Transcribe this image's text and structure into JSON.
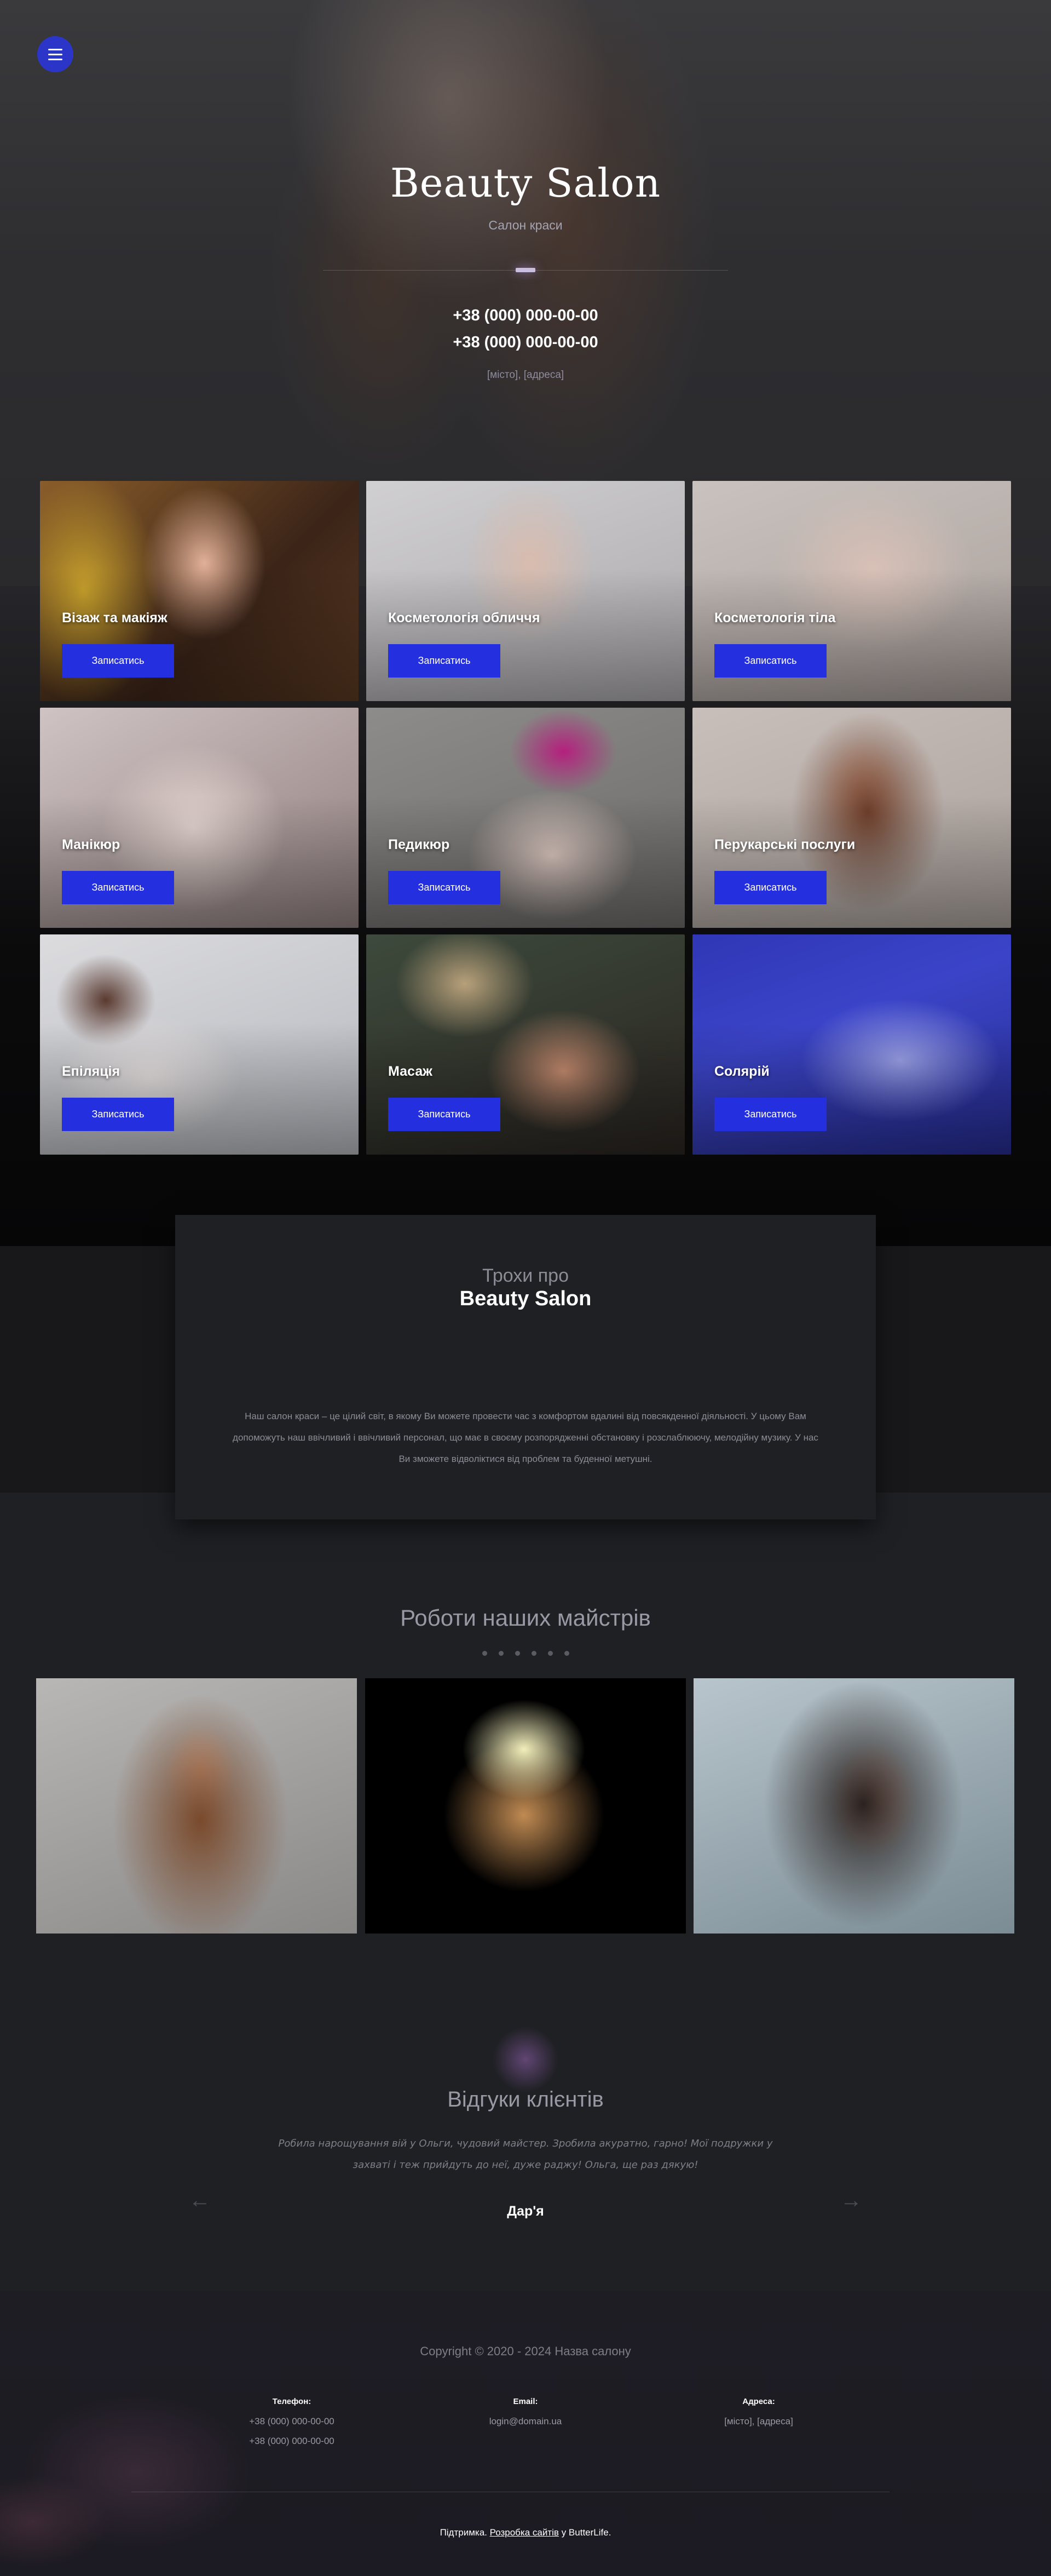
{
  "hero": {
    "title": "Beauty Salon",
    "subtitle": "Салон краси",
    "phone1": "+38 (000) 000-00-00",
    "phone2": "+38 (000) 000-00-00",
    "address": "[місто], [адреса]"
  },
  "menu": {
    "icon": "hamburger-menu-icon",
    "accent": "#2b35c8"
  },
  "services": {
    "button_color": "#2430e0",
    "items": [
      {
        "title": "Візаж та макіяж",
        "button": "Записатись"
      },
      {
        "title": "Косметологія обличчя",
        "button": "Записатись"
      },
      {
        "title": "Косметологія тіла",
        "button": "Записатись"
      },
      {
        "title": "Манікюр",
        "button": "Записатись"
      },
      {
        "title": "Педикюр",
        "button": "Записатись"
      },
      {
        "title": "Перукарські послуги",
        "button": "Записатись"
      },
      {
        "title": "Епіляція",
        "button": "Записатись"
      },
      {
        "title": "Масаж",
        "button": "Записатись"
      },
      {
        "title": "Солярій",
        "button": "Записатись"
      }
    ]
  },
  "about": {
    "pretitle": "Трохи про",
    "title": "Beauty Salon",
    "text": "Наш салон краси – це цілий світ, в якому Ви можете провести час з комфортом вдалині від повсякденної діяльності. У цьому Вам допоможуть наш ввічливий і ввічливий персонал, що має в своєму розпорядженні обстановку і розслаблюючу, мелодійну музику. У нас Ви зможете відволіктися від проблем та буденної метушні."
  },
  "works": {
    "title": "Роботи наших майстрів",
    "dot_count": 6
  },
  "reviews": {
    "title": "Відгуки клієнтів",
    "text": "Робила нарощування вій у Ольги, чудовий майстер. Зробила акуратно, гарно! Мої подружки у захваті і теж прийдуть до неї, дуже раджу! Ольга, ще раз дякую!",
    "author": "Дар'я",
    "prev_icon": "arrow-left-icon",
    "next_icon": "arrow-right-icon"
  },
  "footer": {
    "copyright": "Copyright © 2020 - 2024 Назва салону",
    "phone_label": "Телефон:",
    "phone1": "+38 (000) 000-00-00",
    "phone2": "+38 (000) 000-00-00",
    "email_label": "Email:",
    "email": "login@domain.ua",
    "address_label": "Адреса:",
    "address": "[місто], [адреса]",
    "credits_prefix": "Підтримка.",
    "credits_link": "Розробка сайтів",
    "credits_suffix": "у ButterLife."
  }
}
